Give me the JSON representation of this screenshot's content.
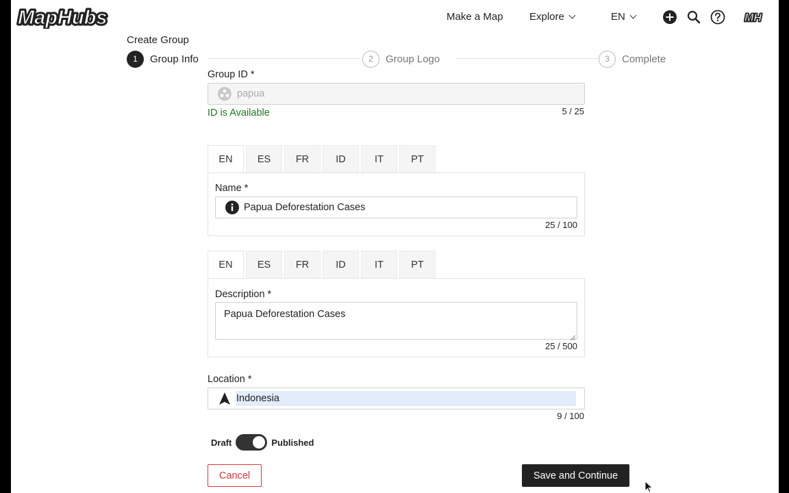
{
  "header": {
    "logo_text": "MapHubs",
    "nav": {
      "make_map": "Make a Map",
      "explore": "Explore",
      "language": "EN"
    },
    "user_badge": "MH",
    "icons": [
      "plus-circle-icon",
      "search-icon",
      "help-circle-icon"
    ]
  },
  "page": {
    "title": "Create Group"
  },
  "stepper": {
    "steps": [
      {
        "number": "1",
        "label": "Group Info",
        "state": "active"
      },
      {
        "number": "2",
        "label": "Group Logo",
        "state": "inactive"
      },
      {
        "number": "3",
        "label": "Complete",
        "state": "inactive"
      }
    ]
  },
  "form": {
    "group_id": {
      "label": "Group ID *",
      "value": "papua",
      "status": "ID is Available",
      "counter": "5 / 25"
    },
    "language_tabs": [
      "EN",
      "ES",
      "FR",
      "ID",
      "IT",
      "PT"
    ],
    "name": {
      "active_tab": "EN",
      "label": "Name *",
      "value": "Papua Deforestation Cases",
      "counter": "25 / 100"
    },
    "description": {
      "active_tab": "EN",
      "label": "Description *",
      "value": "Papua Deforestation Cases",
      "counter": "25 / 500"
    },
    "location": {
      "label": "Location *",
      "value": "Indonesia",
      "counter": "9 / 100"
    },
    "publish_toggle": {
      "off_label": "Draft",
      "on_label": "Published",
      "state": "published"
    },
    "buttons": {
      "cancel": "Cancel",
      "save": "Save and Continue"
    }
  },
  "colors": {
    "accent_dark": "#222222",
    "available_green": "#1a7a1a",
    "cancel_red": "#d9363e",
    "selection_blue": "#e3ecfa"
  }
}
